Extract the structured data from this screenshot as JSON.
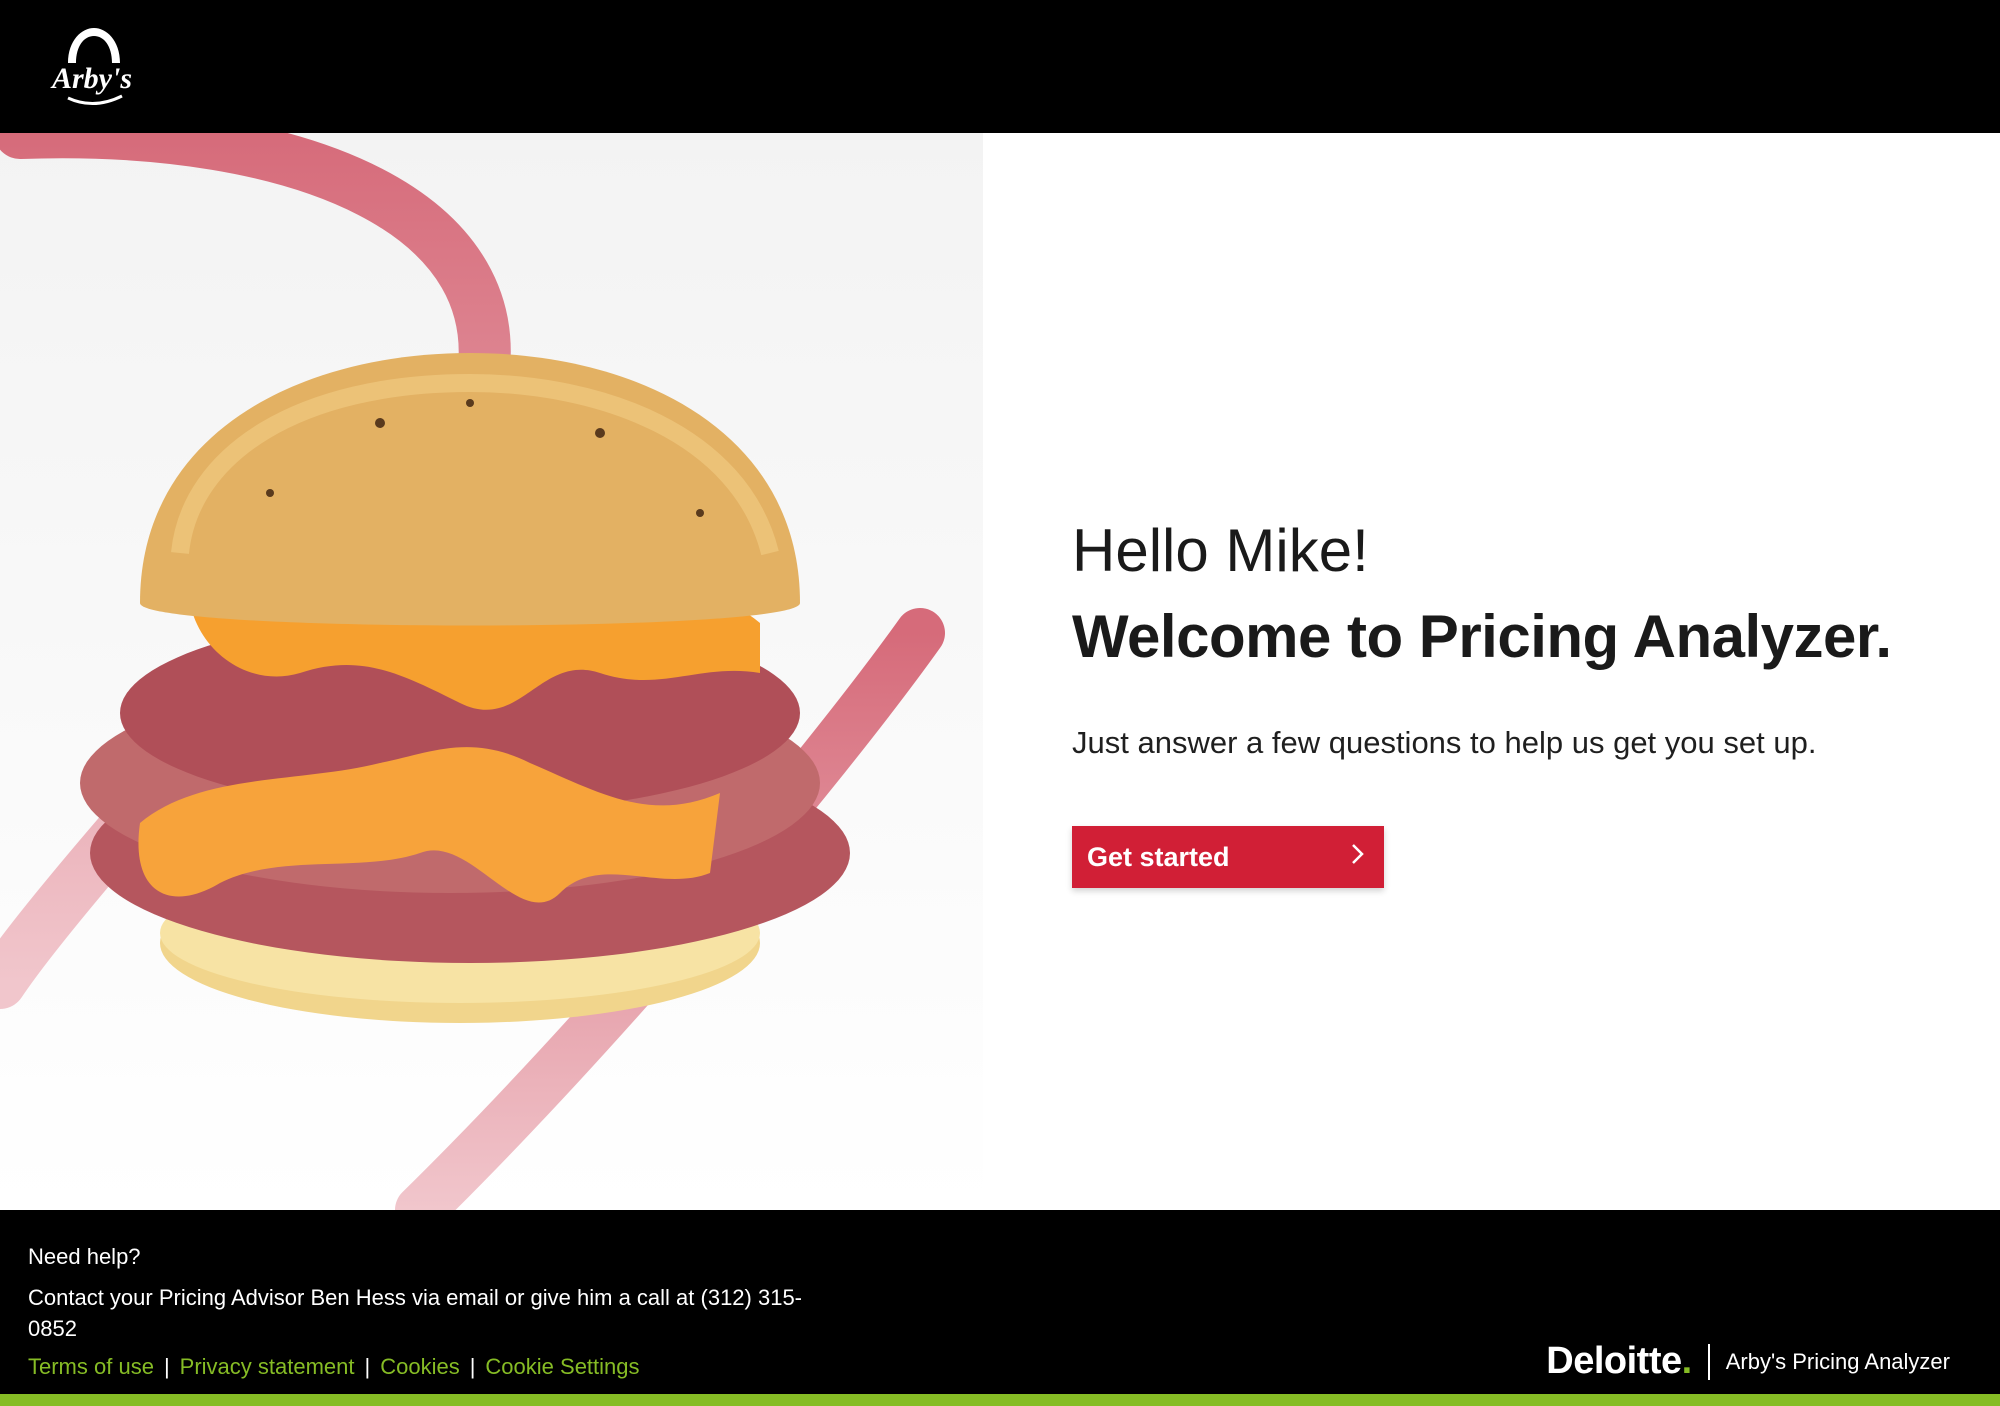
{
  "header": {
    "logo_text": "Arby's"
  },
  "welcome": {
    "greeting": "Hello Mike!",
    "title": "Welcome to Pricing Analyzer.",
    "subtitle": "Just answer a few questions to help us get you set up.",
    "cta_label": "Get started",
    "cta_icon": "chevron-right-icon"
  },
  "footer": {
    "help_title": "Need help?",
    "help_text": "Contact your Pricing Advisor Ben Hess via email or give him a call at (312) 315-0852",
    "links": [
      "Terms of use",
      "Privacy statement",
      "Cookies",
      "Cookie Settings"
    ],
    "brand": "Deloitte",
    "app_name": "Arby's Pricing Analyzer"
  },
  "colors": {
    "accent_red": "#d11f36",
    "link_green": "#86bc25",
    "header_bg": "#000000",
    "swoosh_pink": "#d9707f"
  }
}
